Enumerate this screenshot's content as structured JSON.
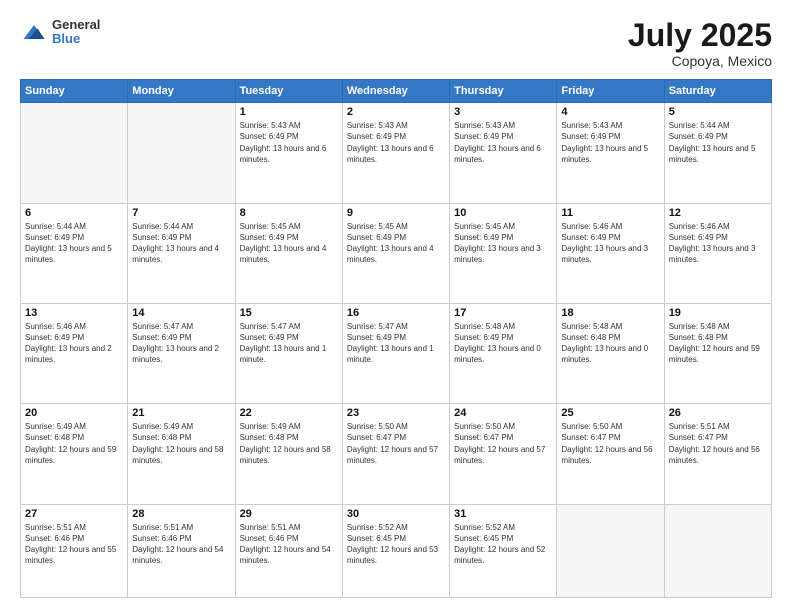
{
  "header": {
    "logo_line1": "General",
    "logo_line2": "Blue",
    "title": "July 2025",
    "location": "Copoya, Mexico"
  },
  "weekdays": [
    "Sunday",
    "Monday",
    "Tuesday",
    "Wednesday",
    "Thursday",
    "Friday",
    "Saturday"
  ],
  "weeks": [
    [
      {
        "day": "",
        "info": ""
      },
      {
        "day": "",
        "info": ""
      },
      {
        "day": "1",
        "info": "Sunrise: 5:43 AM\nSunset: 6:49 PM\nDaylight: 13 hours and 6 minutes."
      },
      {
        "day": "2",
        "info": "Sunrise: 5:43 AM\nSunset: 6:49 PM\nDaylight: 13 hours and 6 minutes."
      },
      {
        "day": "3",
        "info": "Sunrise: 5:43 AM\nSunset: 6:49 PM\nDaylight: 13 hours and 6 minutes."
      },
      {
        "day": "4",
        "info": "Sunrise: 5:43 AM\nSunset: 6:49 PM\nDaylight: 13 hours and 5 minutes."
      },
      {
        "day": "5",
        "info": "Sunrise: 5:44 AM\nSunset: 6:49 PM\nDaylight: 13 hours and 5 minutes."
      }
    ],
    [
      {
        "day": "6",
        "info": "Sunrise: 5:44 AM\nSunset: 6:49 PM\nDaylight: 13 hours and 5 minutes."
      },
      {
        "day": "7",
        "info": "Sunrise: 5:44 AM\nSunset: 6:49 PM\nDaylight: 13 hours and 4 minutes."
      },
      {
        "day": "8",
        "info": "Sunrise: 5:45 AM\nSunset: 6:49 PM\nDaylight: 13 hours and 4 minutes."
      },
      {
        "day": "9",
        "info": "Sunrise: 5:45 AM\nSunset: 6:49 PM\nDaylight: 13 hours and 4 minutes."
      },
      {
        "day": "10",
        "info": "Sunrise: 5:45 AM\nSunset: 6:49 PM\nDaylight: 13 hours and 3 minutes."
      },
      {
        "day": "11",
        "info": "Sunrise: 5:46 AM\nSunset: 6:49 PM\nDaylight: 13 hours and 3 minutes."
      },
      {
        "day": "12",
        "info": "Sunrise: 5:46 AM\nSunset: 6:49 PM\nDaylight: 13 hours and 3 minutes."
      }
    ],
    [
      {
        "day": "13",
        "info": "Sunrise: 5:46 AM\nSunset: 6:49 PM\nDaylight: 13 hours and 2 minutes."
      },
      {
        "day": "14",
        "info": "Sunrise: 5:47 AM\nSunset: 6:49 PM\nDaylight: 13 hours and 2 minutes."
      },
      {
        "day": "15",
        "info": "Sunrise: 5:47 AM\nSunset: 6:49 PM\nDaylight: 13 hours and 1 minute."
      },
      {
        "day": "16",
        "info": "Sunrise: 5:47 AM\nSunset: 6:49 PM\nDaylight: 13 hours and 1 minute."
      },
      {
        "day": "17",
        "info": "Sunrise: 5:48 AM\nSunset: 6:49 PM\nDaylight: 13 hours and 0 minutes."
      },
      {
        "day": "18",
        "info": "Sunrise: 5:48 AM\nSunset: 6:48 PM\nDaylight: 13 hours and 0 minutes."
      },
      {
        "day": "19",
        "info": "Sunrise: 5:48 AM\nSunset: 6:48 PM\nDaylight: 12 hours and 59 minutes."
      }
    ],
    [
      {
        "day": "20",
        "info": "Sunrise: 5:49 AM\nSunset: 6:48 PM\nDaylight: 12 hours and 59 minutes."
      },
      {
        "day": "21",
        "info": "Sunrise: 5:49 AM\nSunset: 6:48 PM\nDaylight: 12 hours and 58 minutes."
      },
      {
        "day": "22",
        "info": "Sunrise: 5:49 AM\nSunset: 6:48 PM\nDaylight: 12 hours and 58 minutes."
      },
      {
        "day": "23",
        "info": "Sunrise: 5:50 AM\nSunset: 6:47 PM\nDaylight: 12 hours and 57 minutes."
      },
      {
        "day": "24",
        "info": "Sunrise: 5:50 AM\nSunset: 6:47 PM\nDaylight: 12 hours and 57 minutes."
      },
      {
        "day": "25",
        "info": "Sunrise: 5:50 AM\nSunset: 6:47 PM\nDaylight: 12 hours and 56 minutes."
      },
      {
        "day": "26",
        "info": "Sunrise: 5:51 AM\nSunset: 6:47 PM\nDaylight: 12 hours and 56 minutes."
      }
    ],
    [
      {
        "day": "27",
        "info": "Sunrise: 5:51 AM\nSunset: 6:46 PM\nDaylight: 12 hours and 55 minutes."
      },
      {
        "day": "28",
        "info": "Sunrise: 5:51 AM\nSunset: 6:46 PM\nDaylight: 12 hours and 54 minutes."
      },
      {
        "day": "29",
        "info": "Sunrise: 5:51 AM\nSunset: 6:46 PM\nDaylight: 12 hours and 54 minutes."
      },
      {
        "day": "30",
        "info": "Sunrise: 5:52 AM\nSunset: 6:45 PM\nDaylight: 12 hours and 53 minutes."
      },
      {
        "day": "31",
        "info": "Sunrise: 5:52 AM\nSunset: 6:45 PM\nDaylight: 12 hours and 52 minutes."
      },
      {
        "day": "",
        "info": ""
      },
      {
        "day": "",
        "info": ""
      }
    ]
  ]
}
